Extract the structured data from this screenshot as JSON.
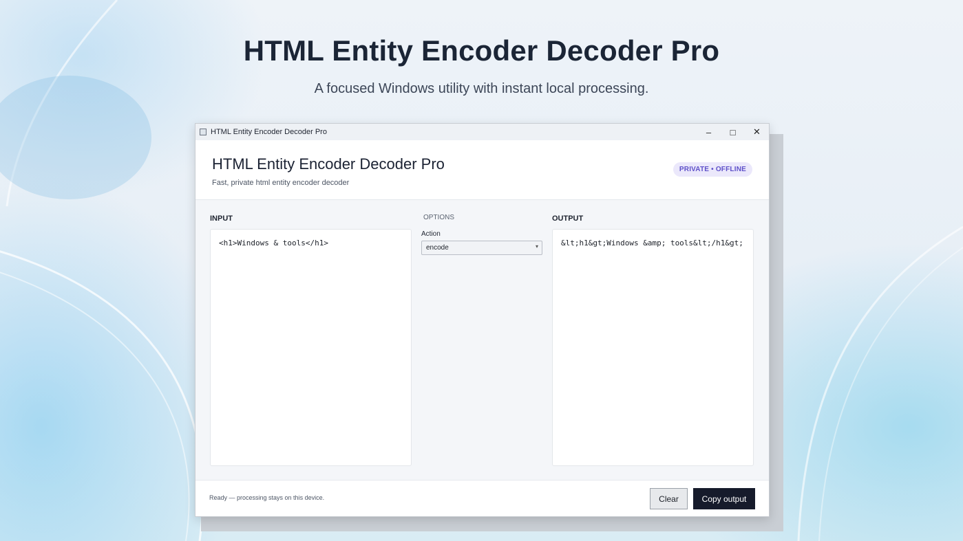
{
  "hero": {
    "title": "HTML Entity Encoder Decoder Pro",
    "subtitle": "A focused Windows utility with instant local processing."
  },
  "window": {
    "title": "HTML Entity Encoder Decoder Pro",
    "controls": {
      "minimize": "–",
      "maximize": "□",
      "close": "✕"
    }
  },
  "header": {
    "title": "HTML Entity Encoder Decoder Pro",
    "subtitle": "Fast, private html entity encoder decoder",
    "badge": "PRIVATE • OFFLINE"
  },
  "input": {
    "label": "INPUT",
    "value": "<h1>Windows & tools</h1>"
  },
  "options": {
    "label": "OPTIONS",
    "action_label": "Action",
    "action_value": "encode"
  },
  "output": {
    "label": "OUTPUT",
    "value": "&lt;h1&gt;Windows &amp; tools&lt;/h1&gt;"
  },
  "footer": {
    "status": "Ready — processing stays on this device.",
    "clear_label": "Clear",
    "copy_label": "Copy output"
  },
  "colors": {
    "accent_dark": "#161b2b",
    "badge_bg": "#ebe8fb",
    "badge_text": "#5e50c9"
  }
}
